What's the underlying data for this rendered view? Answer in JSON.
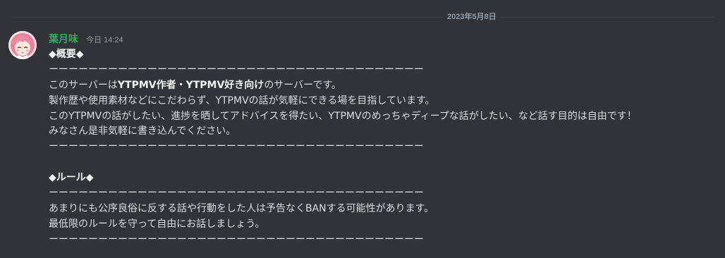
{
  "date_divider": "2023年5月8日",
  "message": {
    "author": "葉月味",
    "timestamp": "今日 14:24",
    "author_color": "#3ba55c",
    "avatar_icon": "pink-haired-anime-girl-avatar",
    "lines": {
      "l1": "◆概要◆",
      "l2": "ーーーーーーーーーーーーーーーーーーーーーーーーーーーーーーーーーーーーーー",
      "l3a": "このサーバーは",
      "l3b": "YTPMV作者・YTPMV好き向け",
      "l3c": "のサーバーです。",
      "l4": "製作歴や使用素材などにこだわらず、YTPMVの話が気軽にできる場を目指しています。",
      "l5": "このYTPMVの話がしたい、進捗を晒してアドバイスを得たい、YTPMVのめっちゃディープな話がしたい、など話す目的は自由です！",
      "l6": "みなさん是非気軽に書き込んでください。",
      "l7": "ーーーーーーーーーーーーーーーーーーーーーーーーーーーーーーーーーーーーーー",
      "l8": "",
      "l9": "◆ルール◆",
      "l10": "ーーーーーーーーーーーーーーーーーーーーーーーーーーーーーーーーーーーーーー",
      "l11": "あまりにも公序良俗に反する話や行動をした人は予告なくBANする可能性があります。",
      "l12": "最低限のルールを守って自由にお話しましょう。",
      "l13": "ーーーーーーーーーーーーーーーーーーーーーーーーーーーーーーーーーーーーーー"
    }
  }
}
